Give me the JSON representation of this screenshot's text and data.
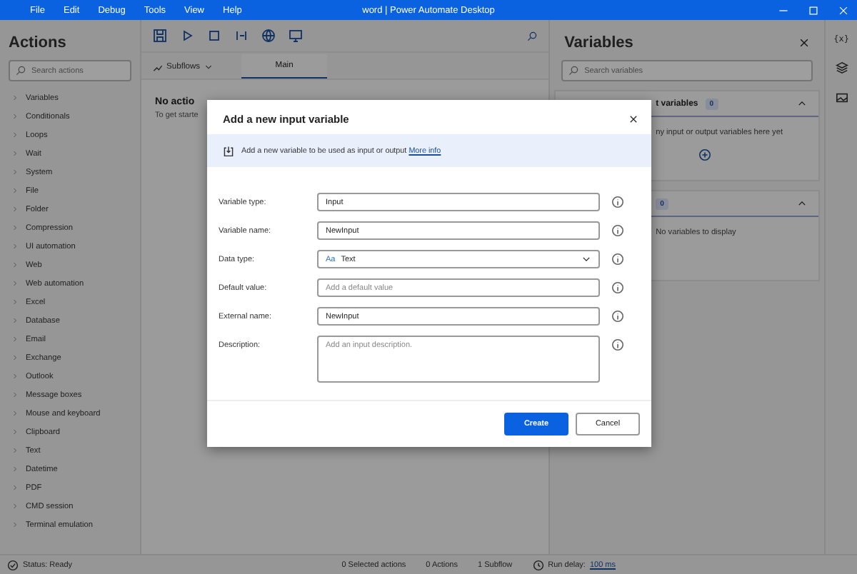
{
  "window": {
    "title": "word | Power Automate Desktop",
    "menu": [
      "File",
      "Edit",
      "Debug",
      "Tools",
      "View",
      "Help"
    ]
  },
  "actions_panel": {
    "title": "Actions",
    "search": {
      "placeholder": "Search actions"
    },
    "items": [
      "Variables",
      "Conditionals",
      "Loops",
      "Wait",
      "System",
      "File",
      "Folder",
      "Compression",
      "UI automation",
      "Web",
      "Web automation",
      "Excel",
      "Database",
      "Email",
      "Exchange",
      "Outlook",
      "Message boxes",
      "Mouse and keyboard",
      "Clipboard",
      "Text",
      "Datetime",
      "PDF",
      "CMD session",
      "Terminal emulation"
    ]
  },
  "flow": {
    "subflows_label": "Subflows",
    "tabs": [
      {
        "label": "Main",
        "selected": true
      }
    ],
    "empty_title": "No actio",
    "empty_hint": "To get starte"
  },
  "variables_panel": {
    "title": "Variables",
    "search": {
      "placeholder": "Search variables"
    },
    "sections": [
      {
        "kind": "io",
        "title": "t variables",
        "count": "0",
        "message": "ny input or output variables here yet"
      },
      {
        "kind": "flow",
        "count": "0",
        "message": "No variables to display"
      }
    ]
  },
  "dialog": {
    "title": "Add a new input variable",
    "info": "Add a new variable to be used as input or output",
    "info_link": "More info",
    "fields": [
      {
        "label": "Variable type:",
        "kind": "text",
        "value": "Input"
      },
      {
        "label": "Variable name:",
        "kind": "text",
        "value": "NewInput"
      },
      {
        "label": "Data type:",
        "kind": "dropdown",
        "prefix": "Aa",
        "value": "Text"
      },
      {
        "label": "Default value:",
        "kind": "text",
        "placeholder": "Add a default value"
      },
      {
        "label": "External name:",
        "kind": "text",
        "value": "NewInput"
      },
      {
        "label": "Description:",
        "kind": "textarea",
        "placeholder": "Add an input description."
      }
    ],
    "buttons": [
      {
        "label": "Create",
        "kind": "primary"
      },
      {
        "label": "Cancel",
        "kind": "secondary"
      }
    ]
  },
  "side_strip": {
    "variables_label": "{x}"
  },
  "status_bar": {
    "status": "Status: Ready",
    "selected_actions": "0 Selected actions",
    "actions": "0 Actions",
    "subflows": "1 Subflow",
    "run_delay_label": "Run delay:",
    "run_delay_value": "100 ms"
  }
}
